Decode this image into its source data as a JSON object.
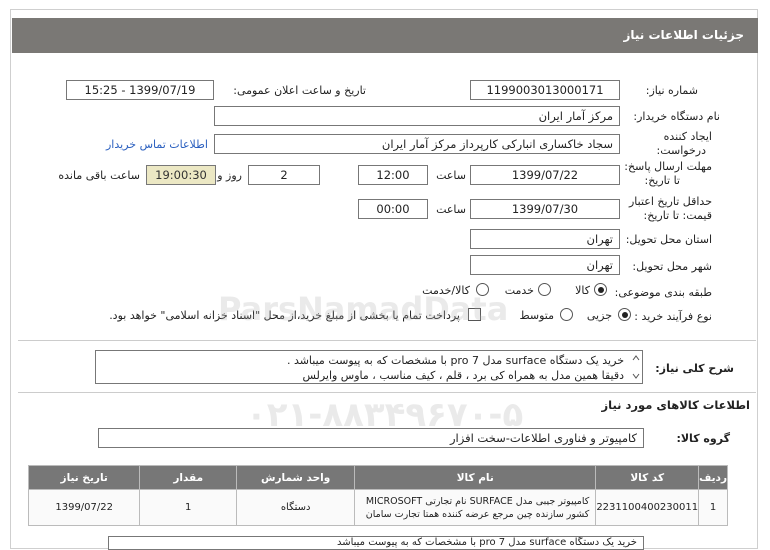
{
  "header": {
    "title": "جزئیات اطلاعات نیاز"
  },
  "fields": {
    "need_number_label": "شماره نیاز:",
    "need_number": "1199003013000171",
    "announce_label": "تاریخ و ساعت اعلان عمومی:",
    "announce_value": "1399/07/19 - 15:25",
    "buyer_org_label": "نام دستگاه خریدار:",
    "buyer_org": "مرکز آمار ایران",
    "creator_label_1": "ایجاد کننده",
    "creator_label_2": "درخواست:",
    "creator": "سجاد خاکساری انبارکی کارپرداز مرکز آمار ایران",
    "contact_link": "اطلاعات تماس خریدار",
    "deadline_label_1": "مهلت ارسال پاسخ:",
    "deadline_label_2": "تا تاریخ:",
    "deadline_date": "1399/07/22",
    "time_label": "ساعت",
    "deadline_time": "12:00",
    "days_value": "2",
    "days_label": "روز و",
    "remaining_time": "19:00:30",
    "remaining_label": "ساعت باقی مانده",
    "validity_label_1": "حداقل تاریخ اعتبار",
    "validity_label_2": "قیمت: تا تاریخ:",
    "validity_date": "1399/07/30",
    "validity_time_label": "ساعت",
    "validity_time": "00:00",
    "province_label": "استان محل تحویل:",
    "province": "تهران",
    "city_label": "شهر محل تحویل:",
    "city": "تهران",
    "category_label": "طبقه بندی موضوعی:",
    "category_options": [
      "کالا",
      "خدمت",
      "کالا/خدمت"
    ],
    "purchase_label": "نوع فرآیند خرید :",
    "purchase_options": [
      "جزیی",
      "متوسط"
    ],
    "payment_note": "پرداخت تمام یا بخشی از مبلغ خرید،از محل \"اسناد خزانه اسلامی\" خواهد بود."
  },
  "description": {
    "label": "شرح کلی نیاز:",
    "line1": "خرید یک دستگاه surface مدل pro 7  با مشخصات که به پیوست میباشد .",
    "line2": "دقیقا همین مدل به همراه کی برد ، قلم ، کیف مناسب ، ماوس وایرلس"
  },
  "goods_section": {
    "title": "اطلاعات کالاهای مورد نیاز",
    "group_label": "گروه کالا:",
    "group_value": "کامپیوتر و فناوری اطلاعات-سخت افزار"
  },
  "table": {
    "headers": [
      "ردیف",
      "کد کالا",
      "نام کالا",
      "واحد شمارش",
      "مقدار",
      "تاریخ نیاز"
    ],
    "rows": [
      {
        "row": "1",
        "code": "2231100400230011",
        "name_line1": "کامپیوتر جیبی مدل SURFACE نام تجارتی MICROSOFT",
        "name_line2": "کشور سازنده چین مرجع عرضه کننده همتا تجارت سامان",
        "unit": "دستگاه",
        "qty": "1",
        "date": "1399/07/22"
      }
    ]
  },
  "bottom_desc_partial": "خرید یک دستگاه surface مدل pro 7  با مشخصات که به پیوست میباشد",
  "watermark": {
    "brand": "ParsNamadData",
    "phone": "۰۲۱-۸۸۳۴۹۶۷۰-۵"
  }
}
